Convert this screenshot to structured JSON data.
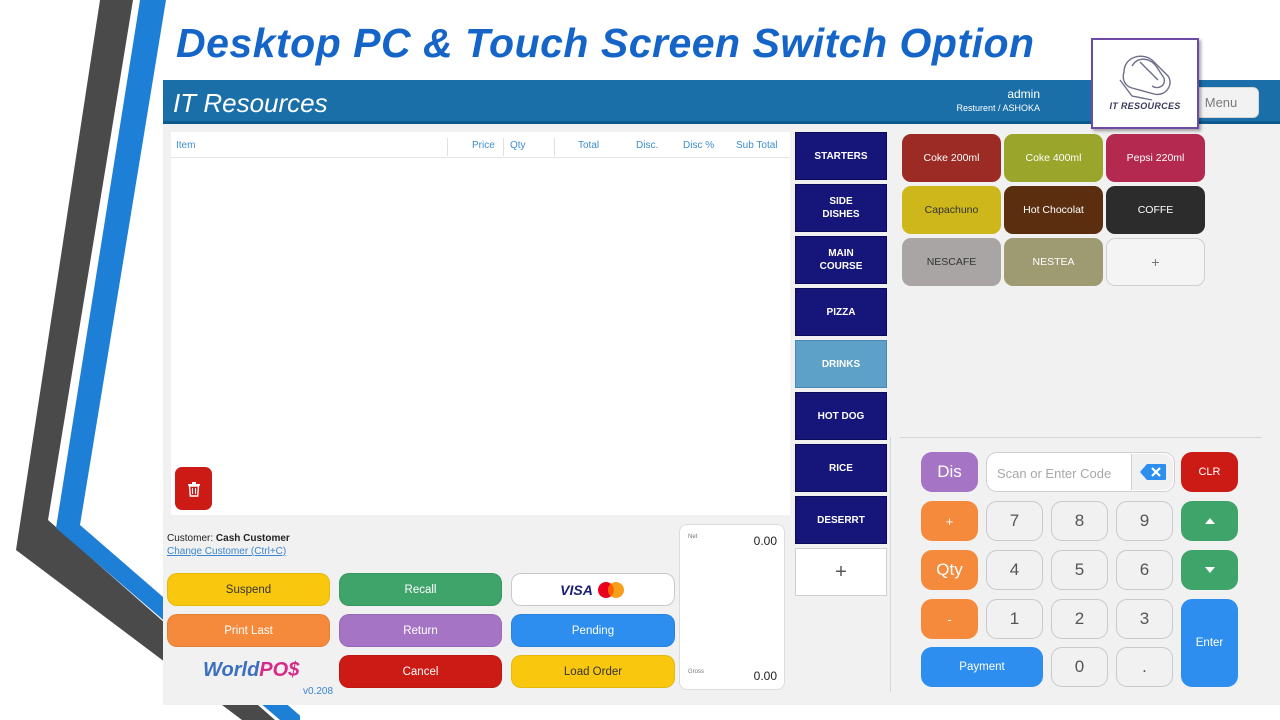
{
  "slide": {
    "title": "Desktop PC & Touch Screen Switch Option"
  },
  "header": {
    "app_title": "IT Resources",
    "user": "admin",
    "location": "Resturent / ASHOKA",
    "menu_label": "Menu"
  },
  "logo": {
    "text": "IT RESOURCES"
  },
  "grid": {
    "columns": [
      "Item",
      "Price",
      "Qty",
      "Total",
      "Disc.",
      "Disc %",
      "Sub Total"
    ],
    "rows": []
  },
  "customer": {
    "label": "Customer:",
    "name": "Cash Customer",
    "change_link": "Change Customer (Ctrl+C)"
  },
  "actions": {
    "suspend": "Suspend",
    "recall": "Recall",
    "card_visa": "VISA",
    "print_last": "Print Last",
    "return": "Return",
    "pending": "Pending",
    "cancel": "Cancel",
    "load_order": "Load Order"
  },
  "brand": {
    "world": "World",
    "pos": "PO$",
    "version": "v0.208"
  },
  "totals": {
    "net_label": "Net",
    "net_value": "0.00",
    "gross_label": "Gross",
    "gross_value": "0.00"
  },
  "categories": [
    {
      "label": "STARTERS",
      "active": false
    },
    {
      "label": "SIDE DISHES",
      "active": false
    },
    {
      "label": "MAIN COURSE",
      "active": false
    },
    {
      "label": "PIZZA",
      "active": false
    },
    {
      "label": "DRINKS",
      "active": true
    },
    {
      "label": "HOT DOG",
      "active": false
    },
    {
      "label": "RICE",
      "active": false
    },
    {
      "label": "DESERRT",
      "active": false
    }
  ],
  "category_add": "+",
  "products": [
    {
      "label": "Coke 200ml",
      "color": "#9b2b24"
    },
    {
      "label": "Coke 400ml",
      "color": "#9aa52b"
    },
    {
      "label": "Pepsi 220ml",
      "color": "#b3294f"
    },
    {
      "label": "Capachuno",
      "color": "#cdb71b",
      "text_color": "#333333"
    },
    {
      "label": "Hot Chocolat",
      "color": "#5b2e0f"
    },
    {
      "label": "COFFE",
      "color": "#2c2c2c"
    },
    {
      "label": "NESCAFE",
      "color": "#a9a5a5",
      "text_color": "#333333"
    },
    {
      "label": "NESTEA",
      "color": "#9e9a72"
    }
  ],
  "product_add": "+",
  "keypad": {
    "dis": "Dis",
    "scan_placeholder": "Scan or Enter Code",
    "clr": "CLR",
    "plus": "+",
    "qty": "Qty",
    "minus": "-",
    "payment": "Payment",
    "enter": "Enter",
    "digits": {
      "seven": "7",
      "eight": "8",
      "nine": "9",
      "four": "4",
      "five": "5",
      "six": "6",
      "one": "1",
      "two": "2",
      "three": "3",
      "zero": "0",
      "dot": "."
    }
  },
  "colors": {
    "header_blue": "#1a6fa8",
    "category_navy": "#16157a",
    "category_active": "#5da0c8",
    "yellow": "#f9c80e",
    "green": "#3fa46a",
    "orange": "#f68a3c",
    "purple": "#a574c5",
    "blue": "#2d8ef0",
    "red": "#cc1a14"
  }
}
